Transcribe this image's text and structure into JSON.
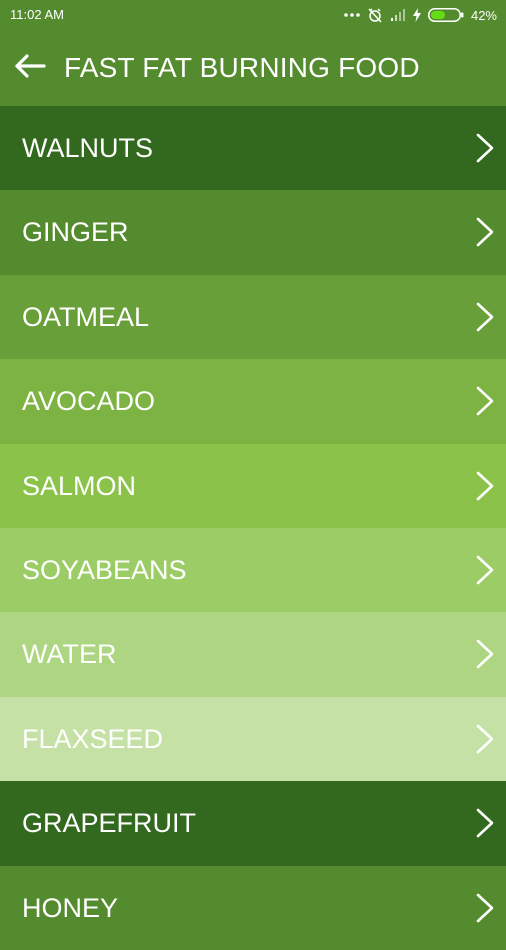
{
  "status_bar": {
    "time": "11:02 AM",
    "battery": "42%",
    "icons": [
      "more-dots-icon",
      "alarm-off-icon",
      "signal-icon",
      "charging-icon",
      "battery-icon"
    ]
  },
  "app_bar": {
    "title": "FAST FAT BURNING FOOD",
    "back_icon": "back-arrow-icon"
  },
  "foods": [
    {
      "label": "WALNUTS",
      "color": "#33691e"
    },
    {
      "label": "GINGER",
      "color": "#558b2f"
    },
    {
      "label": "OATMEAL",
      "color": "#689f38"
    },
    {
      "label": "AVOCADO",
      "color": "#7cb342"
    },
    {
      "label": "SALMON",
      "color": "#8bc34a"
    },
    {
      "label": "SOYABEANS",
      "color": "#9ccc65"
    },
    {
      "label": "WATER",
      "color": "#aed581"
    },
    {
      "label": "FLAXSEED",
      "color": "#c5e1a5"
    },
    {
      "label": "GRAPEFRUIT",
      "color": "#33691e"
    },
    {
      "label": "HONEY",
      "color": "#558b2f"
    }
  ],
  "item_icon": "chevron-right-icon"
}
